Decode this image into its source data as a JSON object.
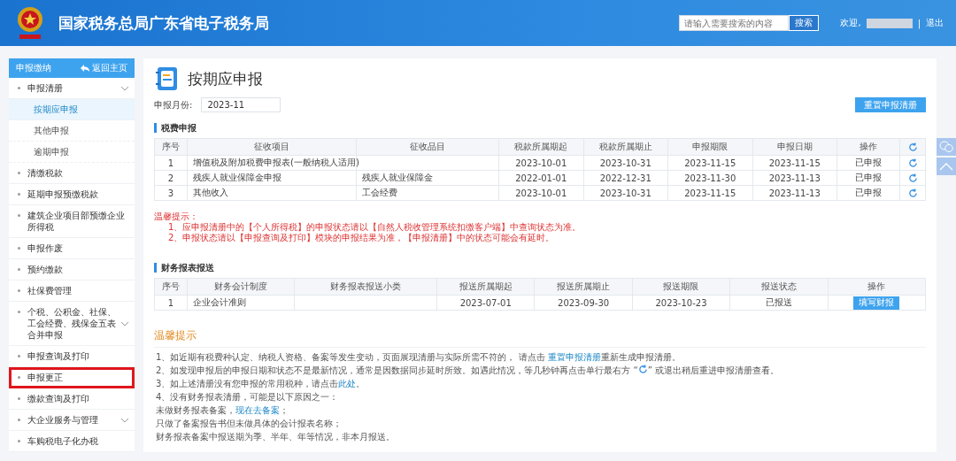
{
  "header": {
    "title": "国家税务总局广东省电子税务局",
    "search": {
      "placeholder": "请输入需要搜索的内容",
      "button": "搜索"
    },
    "welcome": "欢迎,",
    "separator": "|",
    "logout": "退出"
  },
  "sidebar": {
    "title": "申报缴纳",
    "back": "返回主页",
    "items": [
      {
        "label": "申报清册",
        "expandable": true,
        "highlighted": false,
        "children": [
          {
            "label": "按期应申报",
            "selected": true
          },
          {
            "label": "其他申报",
            "selected": false
          },
          {
            "label": "逾期申报",
            "selected": false
          }
        ]
      },
      {
        "label": "清缴税款",
        "expandable": false,
        "highlighted": false
      },
      {
        "label": "延期申报预缴税款",
        "expandable": false,
        "highlighted": false
      },
      {
        "label": "建筑企业项目部预缴企业所得税",
        "expandable": false,
        "highlighted": false
      },
      {
        "label": "申报作废",
        "expandable": false,
        "highlighted": false
      },
      {
        "label": "预约缴款",
        "expandable": false,
        "highlighted": false
      },
      {
        "label": "社保费管理",
        "expandable": false,
        "highlighted": false
      },
      {
        "label": "个税、公积金、社保、工会经费、残保金五表合并申报",
        "expandable": true,
        "highlighted": false
      },
      {
        "label": "申报查询及打印",
        "expandable": false,
        "highlighted": false
      },
      {
        "label": "申报更正",
        "expandable": false,
        "highlighted": true
      },
      {
        "label": "缴款查询及打印",
        "expandable": false,
        "highlighted": false
      },
      {
        "label": "大企业服务与管理",
        "expandable": true,
        "highlighted": false
      },
      {
        "label": "车购税电子化办税",
        "expandable": false,
        "highlighted": false
      }
    ]
  },
  "page": {
    "title": "按期应申报",
    "month_label": "申报月份:",
    "month_value": "2023-11",
    "reset_button": "重置申报清册"
  },
  "tax_section": {
    "title": "税费申报",
    "columns": [
      "序号",
      "征收项目",
      "征收品目",
      "税款所属期起",
      "税款所属期止",
      "申报期限",
      "申报日期",
      "操作"
    ],
    "rows": [
      {
        "cells": [
          "1",
          "增值税及附加税费申报表(一般纳税人适用)",
          "",
          "2023-10-01",
          "2023-10-31",
          "2023-11-15",
          "2023-11-15",
          "已申报"
        ]
      },
      {
        "cells": [
          "2",
          "残疾人就业保障金申报",
          "残疾人就业保障金",
          "2022-01-01",
          "2022-12-31",
          "2023-11-30",
          "2023-11-13",
          "已申报"
        ]
      },
      {
        "cells": [
          "3",
          "其他收入",
          "工会经费",
          "2023-10-01",
          "2023-10-31",
          "2023-11-15",
          "2023-11-13",
          "已申报"
        ]
      }
    ],
    "notes_title": "温馨提示：",
    "notes": [
      "1、应申报清册中的【个人所得税】的申报状态请以【自然人税收管理系统扣缴客户端】中查询状态为准。",
      "2、申报状态请以【申报查询及打印】模块的申报结果为准，【申报清册】中的状态可能会有延时。"
    ]
  },
  "finance_section": {
    "title": "财务报表报送",
    "columns": [
      "序号",
      "财务会计制度",
      "财务报表报送小类",
      "报送所属期起",
      "报送所属期止",
      "报送期限",
      "报送状态",
      "操作"
    ],
    "rows": [
      {
        "cells": [
          "1",
          "企业会计准则",
          "",
          "2023-07-01",
          "2023-09-30",
          "2023-10-23",
          "已报送"
        ],
        "action": "填写财报"
      }
    ]
  },
  "tips": {
    "title": "温馨提示",
    "items": [
      {
        "parts": [
          {
            "kind": "text",
            "text": "1、如近期有税费种认定、纳税人资格、备案等发生变动，页面展现清册与实际所需不符的，  请点击 "
          },
          {
            "kind": "link",
            "text": "重置申报清册"
          },
          {
            "kind": "text",
            "text": "重新生成申报清册。"
          }
        ]
      },
      {
        "parts": [
          {
            "kind": "text",
            "text": "2、如发现申报后的申报日期和状态不是最新情况，通常是因数据同步延时所致。如遇此情况，等几秒钟再点击单行最右方 “"
          },
          {
            "kind": "icon"
          },
          {
            "kind": "text",
            "text": "” 或退出稍后重进申报清册查看。"
          }
        ]
      },
      {
        "parts": [
          {
            "kind": "text",
            "text": "3、如上述清册没有您申报的常用税种，请点击"
          },
          {
            "kind": "link",
            "text": "此处"
          },
          {
            "kind": "text",
            "text": "。"
          }
        ]
      },
      {
        "parts": [
          {
            "kind": "text",
            "text": "4、没有财务报表清册，可能是以下原因之一："
          }
        ]
      },
      {
        "parts": [
          {
            "kind": "text",
            "text": "未做财务报表备案，"
          },
          {
            "kind": "link",
            "text": "现在去备案"
          },
          {
            "kind": "text",
            "text": "；"
          }
        ]
      },
      {
        "parts": [
          {
            "kind": "text",
            "text": "只做了备案报告书但未做具体的会计报表名称；"
          }
        ]
      },
      {
        "parts": [
          {
            "kind": "text",
            "text": "财务报表备案中报送期为季、半年、年等情况，非本月报送。"
          }
        ]
      }
    ]
  }
}
